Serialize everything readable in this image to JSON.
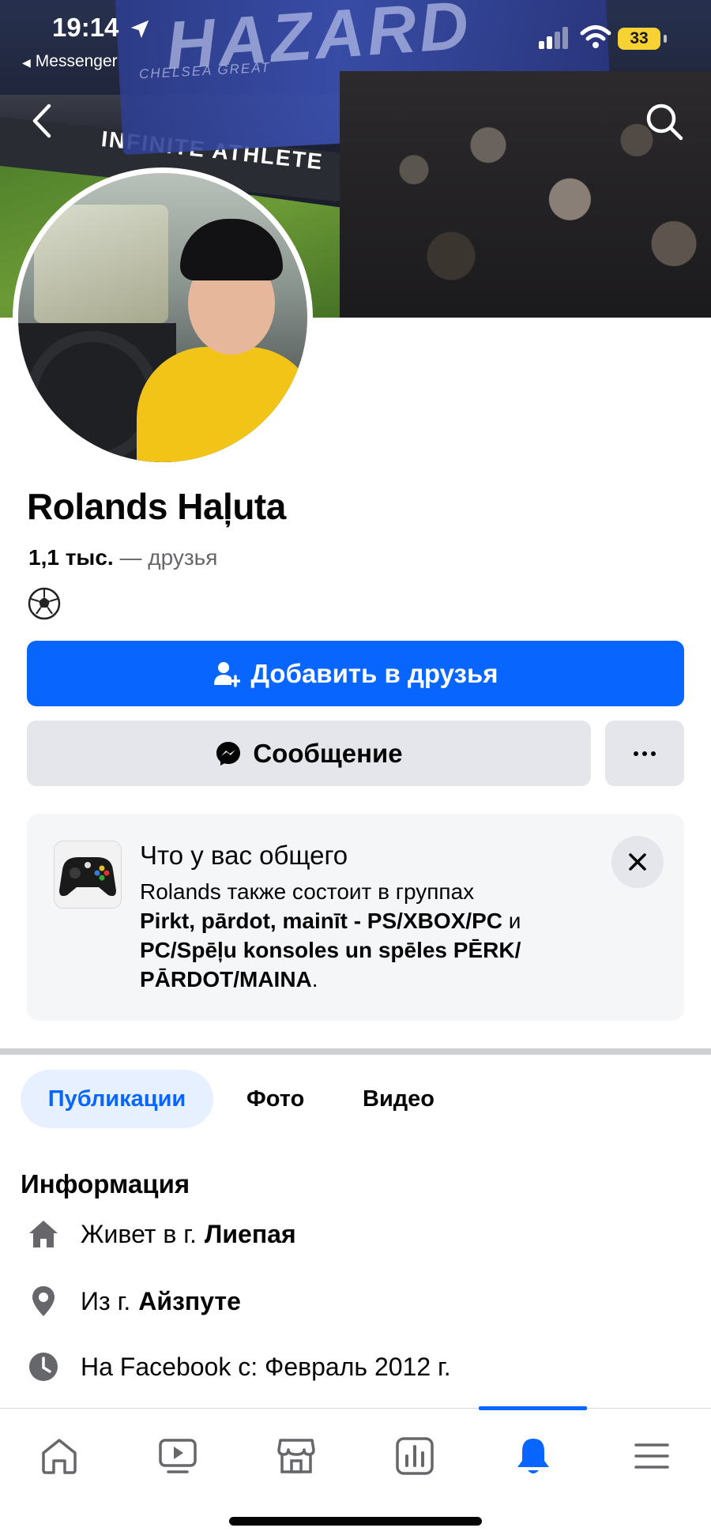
{
  "status_bar": {
    "time": "19:14",
    "back_app": "Messenger",
    "battery": "33"
  },
  "cover": {
    "banner_text": "HAZARD",
    "banner_sub": "CHELSEA GREAT",
    "ad_text": "INFINITE ATHLETE"
  },
  "profile": {
    "name": "Rolands Haļuta",
    "friends_count": "1,1 тыс.",
    "friends_label": "— друзья",
    "bio_emoji": "⚽"
  },
  "actions": {
    "add_friend": "Добавить в друзья",
    "message": "Сообщение",
    "more": "···"
  },
  "common": {
    "title": "Что у вас общего",
    "intro": "Rolands также состоит в группах",
    "group1": "Pirkt, pārdot, mainīt - PS/XBOX/PC",
    "connector": " и ",
    "group2": "PC/Spēļu konsoles  un spēles PĒRK/ PĀRDOT/MAINA",
    "end": "."
  },
  "tabs": [
    "Публикации",
    "Фото",
    "Видео"
  ],
  "info": {
    "title": "Информация",
    "rows": [
      {
        "icon": "home-icon",
        "prefix": "Живет в г.",
        "value": "Лиепая"
      },
      {
        "icon": "location-pin-icon",
        "prefix": "Из г.",
        "value": "Айзпуте"
      },
      {
        "icon": "clock-icon",
        "prefix": "На Facebook с: Февраль 2012 г.",
        "value": ""
      }
    ]
  },
  "bottom_nav": {
    "items": [
      "home-icon",
      "video-icon",
      "marketplace-icon",
      "dashboard-icon",
      "notifications-bell-icon",
      "menu-icon"
    ],
    "active": "notifications-bell-icon"
  },
  "colors": {
    "accent": "#0866ff",
    "secondary_button": "#e4e6eb",
    "text": "#050505",
    "muted": "#65676b",
    "battery": "#f7d232"
  }
}
